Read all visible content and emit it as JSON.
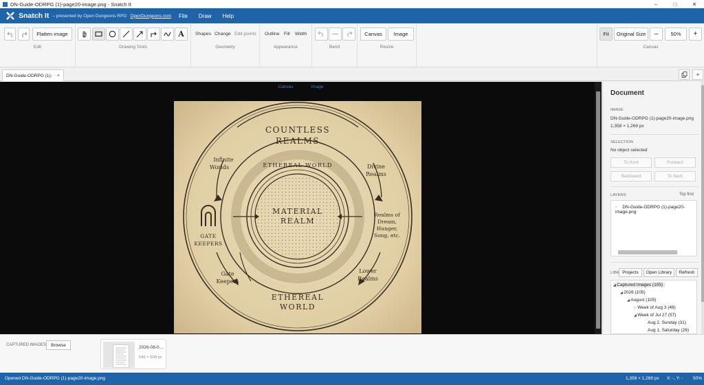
{
  "window": {
    "title": "DN-Guide-ODRPG (1)-page20-image.png - Snatch It",
    "controls": [
      "–",
      "□",
      "✕"
    ]
  },
  "app": {
    "name": "Snatch It",
    "tagline": "– presented by Open Dungeons RPG",
    "link": "OpenDungeons.com"
  },
  "menu": [
    "File",
    "Draw",
    "Help"
  ],
  "ribbon": {
    "edit": {
      "flatten": "Flatten image",
      "label": "Edit"
    },
    "drawing": {
      "label": "Drawing Tools",
      "text_tool": "A"
    },
    "geometry": {
      "shapes": "Shapes",
      "change": "Change",
      "edit_points": "Edit points",
      "label": "Geometry"
    },
    "appearance": {
      "outline": "Outline",
      "fill": "Fill",
      "width": "Width",
      "label": "Appearance"
    },
    "bend": {
      "label": "Bend"
    },
    "resize": {
      "canvas": "Canvas",
      "image": "Image",
      "label": "Resize"
    },
    "canvas": {
      "fit": "Fit",
      "original": "Original Size",
      "minus": "–",
      "zoom": "50%",
      "plus": "+",
      "label": "Canvas"
    }
  },
  "tab": {
    "label": "DN-Guide-ODRPG (1)-",
    "close": "×"
  },
  "tab_actions": {
    "new": "+"
  },
  "canvas_tabs": [
    "Canvas",
    "Image"
  ],
  "artwork": {
    "countless": "COUNTLESS",
    "realms": "REALMS",
    "ethereal_arc": "ETHEREAL WORLD",
    "material": "MATERIAL",
    "realm": "REALM",
    "infinite": "Infinite",
    "worlds": "Worlds",
    "divine": "Divine",
    "divine2": "Realms",
    "gate": "GATE",
    "keepers": "KEEPERS",
    "dream1": "Realms of",
    "dream2": "Dream,",
    "dream3": "Hunger,",
    "dream4": "Song, etc.",
    "gate2a": "Gate",
    "gate2b": "Keepers",
    "lower1": "Lower",
    "lower2": "Realms",
    "ethereal1": "ETHEREAL",
    "ethereal2": "WORLD"
  },
  "panel": {
    "title": "Document",
    "image_label": "Image",
    "image_name": "DN-Guide-ODRPG (1)-page20-image.png",
    "image_size": "1,358 × 1,269 px",
    "selection_label": "Selection",
    "selection_value": "No object selected",
    "to_front": "To front",
    "forward": "Forward",
    "backward": "Backward",
    "to_back": "To back",
    "layers_label": "Layers",
    "top_first": "Top first",
    "layer_name": "DN-Guide-ODRPG (1)-page20-image.png",
    "lib_label": "LIBR",
    "projects": "Projects",
    "open_library": "Open Library",
    "refresh": "Refresh",
    "tree": [
      "Captured Images (105)",
      "2026 (105)",
      "August (105)",
      "Week of Aug 3 (48)",
      "Week of Jul 27 (57)",
      "Aug 2, Sunday (31)",
      "Aug 1, Saturday (26)"
    ]
  },
  "bottom": {
    "label": "Captured images",
    "browse": "Browse",
    "thumb_name": "2026-08-0...",
    "thumb_size": "546 × 608 px"
  },
  "status": {
    "message": "Opened DN-Guide-ODRPG (1)-page20-image.png",
    "dims": "1,358 × 1,269 px",
    "coords": "X: -, Y: -",
    "zoom": "50%"
  },
  "colors": {
    "accent": "#1f63a8",
    "parchment": "#e2cfa6",
    "ink": "#3a2c1c"
  }
}
